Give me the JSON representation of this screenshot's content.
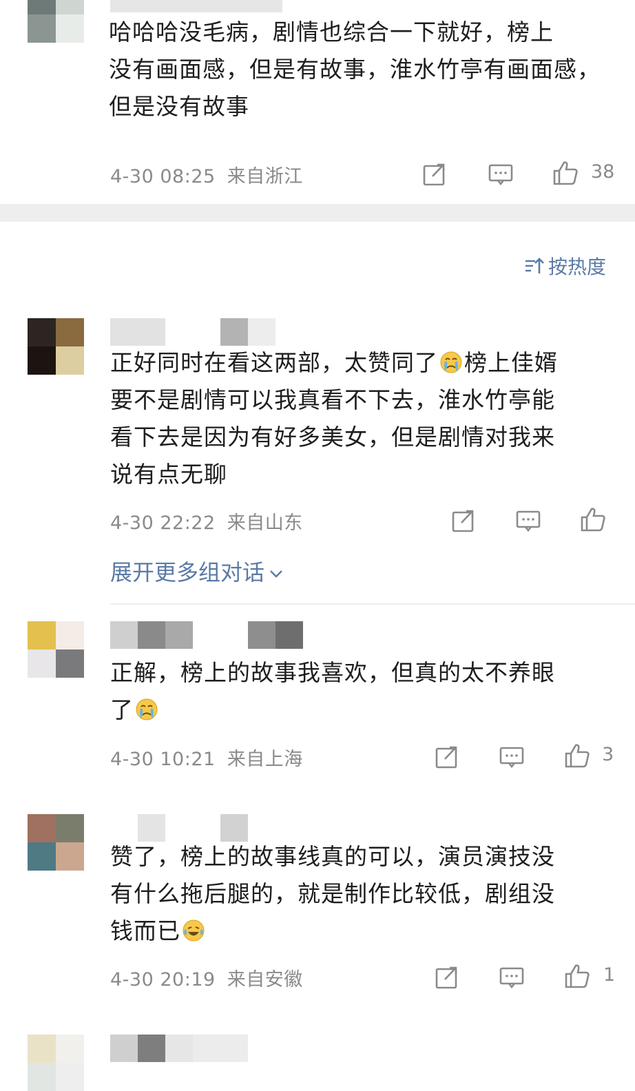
{
  "sort": {
    "label": "按热度",
    "icon": "sort-lines-icon"
  },
  "comments": [
    {
      "lines": [
        "哈哈哈没毛病，剧情也综合一下就好，榜上",
        "没有画面感，但是有故事，淮水竹亭有画面感，",
        "但是没有故事"
      ],
      "time": "4-30 08:25",
      "location": "来自浙江",
      "likes": "38"
    },
    {
      "lines": [
        "正好同时在看这两部，太赞同了",
        "要不是剧情可以我真看不下去，淮水竹亭能",
        "看下去是因为有好多美女，但是剧情对我来",
        "说有点无聊"
      ],
      "line1_after_emoji": "榜上佳婿",
      "emoji": "crying-face-icon",
      "time": "4-30 22:22",
      "location": "来自山东",
      "likes": "",
      "expand": "展开更多组对话"
    },
    {
      "lines": [
        "正解，榜上的故事我喜欢，但真的太不养眼",
        "了"
      ],
      "emoji": "crying-face-icon",
      "time": "4-30 10:21",
      "location": "来自上海",
      "likes": "3"
    },
    {
      "lines": [
        "赞了，榜上的故事线真的可以，演员演技没",
        "有什么拖后腿的，就是制作比较低，剧组没",
        "钱而已"
      ],
      "emoji": "laughing-tears-icon",
      "time": "4-30 20:19",
      "location": "来自安徽",
      "likes": "1"
    }
  ],
  "colors": {
    "meta_gray": "#8a8a8a",
    "link_blue": "#5b7aa6",
    "divider": "#eeeeee"
  }
}
